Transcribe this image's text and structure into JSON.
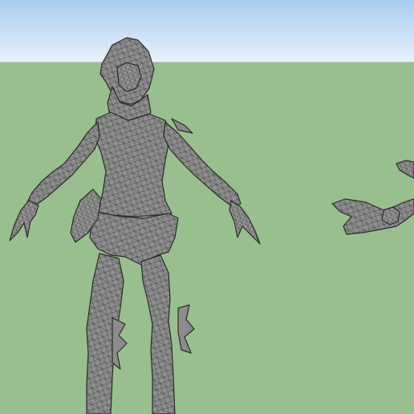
{
  "scene": {
    "sky_top_color": "#a9cdef",
    "sky_bottom_color": "#e7f1fa",
    "ground_color": "#99bf8e",
    "mesh_fill": "#8e8e8e",
    "mesh_edge": "#2e2e2e",
    "mesh_line": "#5a5a5a"
  },
  "models": [
    {
      "name": "character-mesh",
      "kind": "humanoid figure, wireframe mesh"
    },
    {
      "name": "weapon-mesh",
      "kind": "blade prop, wireframe mesh"
    }
  ]
}
